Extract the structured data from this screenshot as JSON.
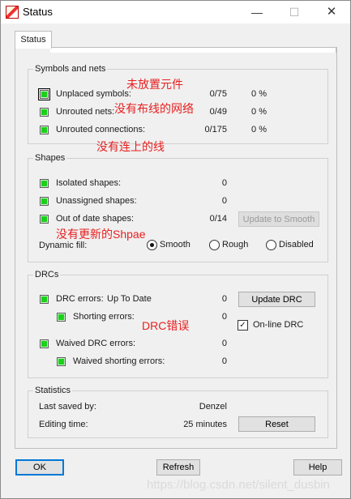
{
  "window": {
    "title": "Status",
    "min_glyph": "—",
    "max_glyph": "☐",
    "close_glyph": "✕"
  },
  "tab": {
    "label": "Status"
  },
  "symbols": {
    "title": "Symbols and nets",
    "rows": [
      {
        "label": "Unplaced symbols:",
        "count": "0/75",
        "pct": "0 %"
      },
      {
        "label": "Unrouted nets:",
        "count": "0/49",
        "pct": "0 %"
      },
      {
        "label": "Unrouted connections:",
        "count": "0/175",
        "pct": "0 %"
      }
    ]
  },
  "shapes": {
    "title": "Shapes",
    "rows": [
      {
        "label": "Isolated shapes:",
        "value": "0"
      },
      {
        "label": "Unassigned shapes:",
        "value": "0"
      },
      {
        "label": "Out of date shapes:",
        "value": "0/14"
      }
    ],
    "update_button": "Update to Smooth",
    "dynamic_fill_label": "Dynamic fill:",
    "fill_options": [
      "Smooth",
      "Rough",
      "Disabled"
    ],
    "fill_selected": "Smooth"
  },
  "drcs": {
    "title": "DRCs",
    "drc_errors_label": "DRC errors:",
    "drc_status": "Up To Date",
    "drc_errors_value": "0",
    "shorting_label": "Shorting errors:",
    "shorting_value": "0",
    "waived_label": "Waived DRC errors:",
    "waived_value": "0",
    "waived_shorting_label": "Waived shorting errors:",
    "waived_shorting_value": "0",
    "update_button": "Update DRC",
    "online_label": "On-line DRC",
    "online_checked": true
  },
  "statistics": {
    "title": "Statistics",
    "last_saved_label": "Last saved by:",
    "last_saved_value": "Denzel",
    "editing_label": "Editing time:",
    "editing_value": "25 minutes",
    "reset_button": "Reset"
  },
  "footer": {
    "ok": "OK",
    "refresh": "Refresh",
    "help": "Help"
  },
  "annotations": {
    "unplaced": "未放置元件",
    "unrouted_nets": "没有布线的网络",
    "unrouted_conn": "没有连上的线",
    "shapes": "没有更新的Shpae",
    "drc": "DRC错误"
  },
  "watermark": "https://blog.csdn.net/silent_dusbin",
  "colors": {
    "indicator": "#1ad11a",
    "annotation": "#e82020",
    "accent": "#0078d7"
  }
}
